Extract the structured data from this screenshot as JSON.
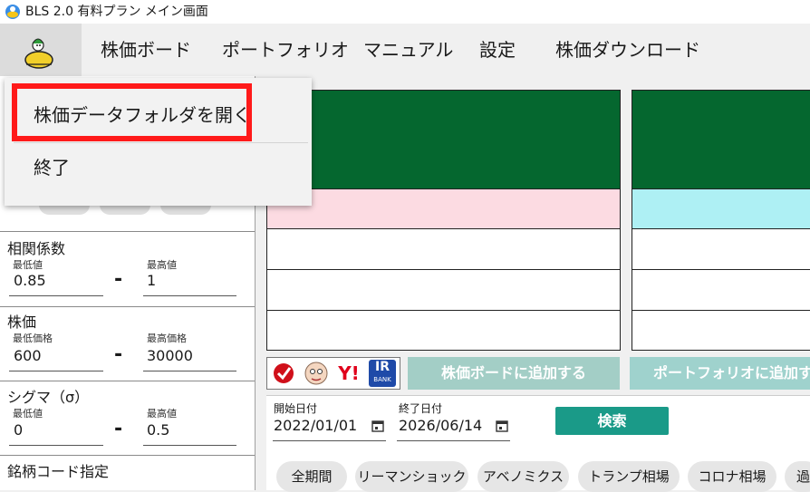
{
  "window": {
    "title": "BLS 2.0 有料プラン メイン画面"
  },
  "menu": {
    "items": [
      "株価ボード",
      "ポートフォリオ",
      "マニュアル",
      "設定",
      "株価ダウンロード"
    ]
  },
  "dropdown": {
    "items": [
      "株価データフォルダを開く",
      "終了"
    ]
  },
  "filters": {
    "correlation": {
      "title": "相関係数",
      "min_label": "最低値",
      "max_label": "最高値",
      "min": "0.85",
      "max": "1"
    },
    "price": {
      "title": "株価",
      "min_label": "最低価格",
      "max_label": "最高価格",
      "min": "600",
      "max": "30000"
    },
    "sigma": {
      "title": "シグマ（σ）",
      "min_label": "最低値",
      "max_label": "最高値",
      "min": "0",
      "max": "0.5"
    },
    "code": {
      "title": "銘柄コード指定"
    },
    "dash": "-"
  },
  "actions": {
    "add_board": "株価ボードに追加する",
    "add_portfolio": "ポートフォリオに追加する"
  },
  "external_icons": {
    "yahoo_text": "Y!",
    "irbank_top": "IR",
    "irbank_bottom": "BANK"
  },
  "dates": {
    "start_label": "開始日付",
    "start": "2022/01/01",
    "end_label": "終了日付",
    "end": "2026/06/14",
    "search": "検索"
  },
  "periods": [
    "全期間",
    "リーマンショック",
    "アベノミクス",
    "トランプ相場",
    "コロナ相場",
    "過"
  ],
  "colors": {
    "green_header": "#05672f",
    "pink_row": "#fcdbe2",
    "cyan_row": "#aef0f4",
    "teal_button": "#1a9a88",
    "highlight_red": "#ff1a1a"
  }
}
